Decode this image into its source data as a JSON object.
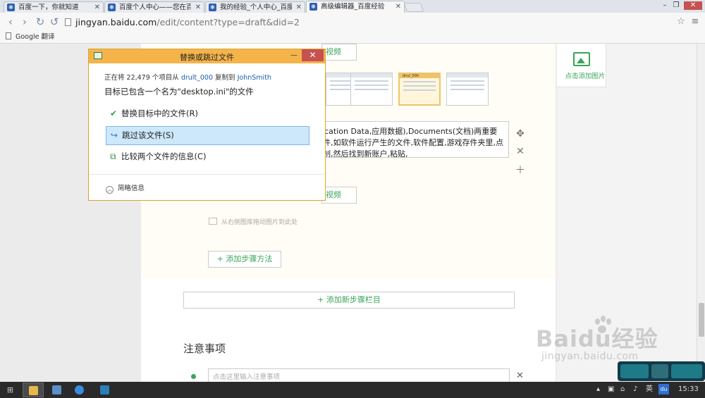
{
  "browser": {
    "tabs": [
      {
        "title": "百度一下，你就知道"
      },
      {
        "title": "百度个人中心——您在百度"
      },
      {
        "title": "我的经验_个人中心_百度经"
      },
      {
        "title": "高级编辑器_百度经验"
      }
    ],
    "url_host": "jingyan.baidu.com",
    "url_path": "/edit/content?type=draft&did=2",
    "bookmark": "Google 翻译"
  },
  "editor": {
    "video_btn_label": "视频",
    "add_image_label": "点击添加图片",
    "step_text": "plication Data,应用数据),Documents(文档)两重要文件,如软件运行产生的文件,软件配置,游戏存件夹里,点复制,然后找到新账户,粘贴,",
    "drop_tip": "从右侧图库拖动图片到此处",
    "add_step_method": "+ 添加步骤方法",
    "add_step_column": "+ 添加新步骤栏目",
    "notes_title": "注意事项",
    "notes_placeholder": "点击这里输入注意事项",
    "thumb_label": "dnul_000"
  },
  "dialog": {
    "title": "替换或跳过文件",
    "progress_prefix": "正在将 22,479 个项目从 ",
    "source": "drult_000",
    "progress_mid": " 复制到 ",
    "dest": "JohnSmith",
    "message": "目标已包含一个名为\"desktop.ini\"的文件",
    "options": [
      {
        "label": "替换目标中的文件(R)"
      },
      {
        "label": "跳过该文件(S)"
      },
      {
        "label": "比较两个文件的信息(C)"
      }
    ],
    "details": "简略信息"
  },
  "watermark": {
    "logo": "Baidu经验",
    "url": "jingyan.baidu.com"
  },
  "taskbar": {
    "clock": "15:33",
    "tray_text": "英"
  }
}
